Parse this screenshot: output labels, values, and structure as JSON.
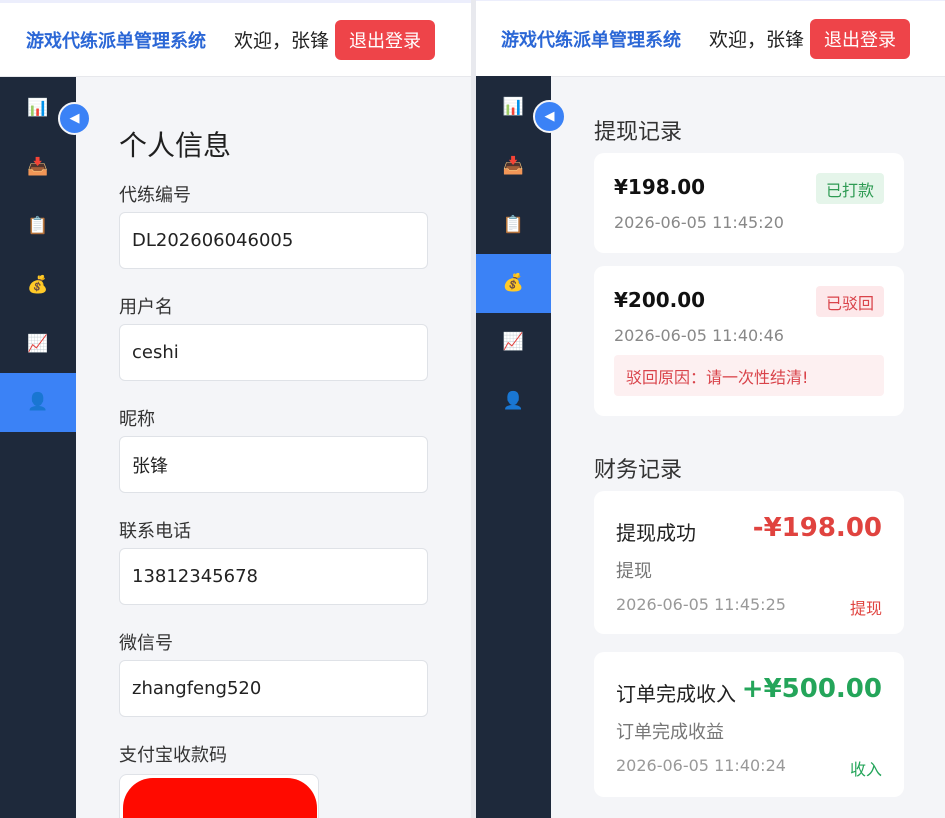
{
  "header": {
    "brand": "游戏代练派单管理系统",
    "welcome": "欢迎，张锋",
    "logout_label": "退出登录"
  },
  "sidebar": {
    "collapse_glyph": "◀",
    "items": [
      {
        "icon": "chart-icon",
        "glyph": "📊"
      },
      {
        "icon": "inbox-tray-icon",
        "glyph": "📥"
      },
      {
        "icon": "clipboard-icon",
        "glyph": "📋"
      },
      {
        "icon": "money-bag-icon",
        "glyph": "💰"
      },
      {
        "icon": "trend-chart-icon",
        "glyph": "📈"
      },
      {
        "icon": "user-icon",
        "glyph": "👤"
      }
    ]
  },
  "profile": {
    "title": "个人信息",
    "fields": [
      {
        "label": "代练编号",
        "value": "DL202606046005"
      },
      {
        "label": "用户名",
        "value": "ceshi"
      },
      {
        "label": "昵称",
        "value": "张锋"
      },
      {
        "label": "联系电话",
        "value": "13812345678"
      },
      {
        "label": "微信号",
        "value": "zhangfeng520"
      },
      {
        "label": "支付宝收款码",
        "value": ""
      }
    ],
    "qr_color": "#ff0a00"
  },
  "withdrawals": {
    "title": "提现记录",
    "records": [
      {
        "amount": "¥198.00",
        "time": "2026-06-05 11:45:20",
        "status": "已打款"
      },
      {
        "amount": "¥200.00",
        "time": "2026-06-05 11:40:46",
        "status": "已驳回",
        "reason": "驳回原因：请一次性结清!"
      }
    ]
  },
  "finance": {
    "title": "财务记录",
    "records": [
      {
        "title": "提现成功",
        "amount": "-¥198.00",
        "desc": "提现",
        "time": "2026-06-05 11:45:25",
        "type": "提现"
      },
      {
        "title": "订单完成收入",
        "amount": "+¥500.00",
        "desc": "订单完成收益",
        "time": "2026-06-05 11:40:24",
        "type": "收入"
      }
    ]
  },
  "colors": {
    "accent": "#3b82f6",
    "brand": "#2b67d6",
    "danger": "#ee4449",
    "success": "#24a55a",
    "sidebar_bg": "#1e293b"
  }
}
